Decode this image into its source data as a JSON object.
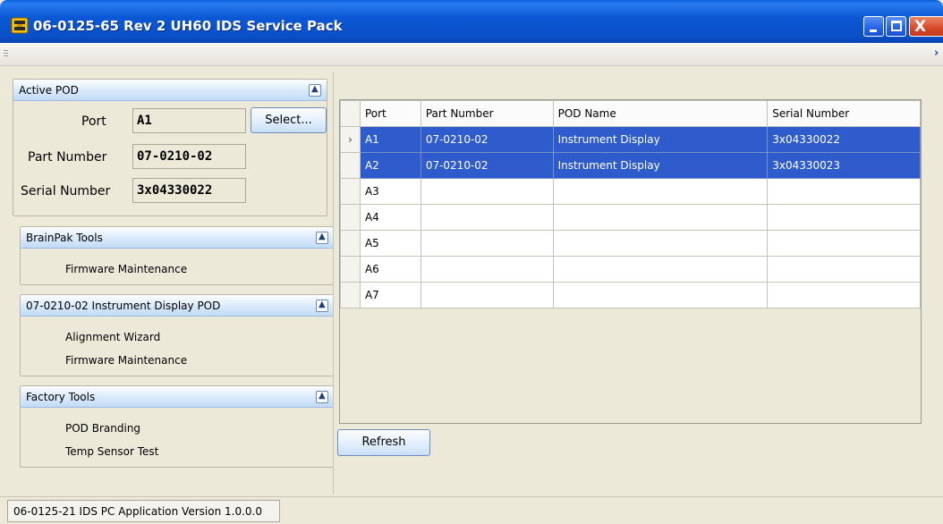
{
  "window": {
    "title": "06-0125-65 Rev 2 UH60 IDS Service Pack",
    "controls": {
      "minimize": "minimize",
      "maximize": "maximize",
      "close": "X"
    }
  },
  "toolstrip": {
    "overflow_glyph": "›"
  },
  "active_pod": {
    "header": "Active POD",
    "port_label": "Port",
    "port_value": "A1",
    "select_label": "Select...",
    "part_number_label": "Part Number",
    "part_number_value": "07-0210-02",
    "serial_number_label": "Serial Number",
    "serial_number_value": "3x04330022"
  },
  "brainpak_tools": {
    "header": "BrainPak Tools",
    "items": [
      "Firmware Maintenance"
    ]
  },
  "instrument_pod": {
    "header": "07-0210-02 Instrument Display POD",
    "items": [
      "Alignment Wizard",
      "Firmware Maintenance"
    ]
  },
  "factory_tools": {
    "header": "Factory Tools",
    "items": [
      "POD Branding",
      "Temp Sensor Test"
    ]
  },
  "grid": {
    "columns": [
      "Port",
      "Part Number",
      "POD Name",
      "Serial Number"
    ],
    "rows": [
      {
        "marker": "›",
        "port": "A1",
        "part_number": "07-0210-02",
        "pod_name": "Instrument Display",
        "serial": "3x04330022",
        "selected": true
      },
      {
        "marker": "",
        "port": "A2",
        "part_number": "07-0210-02",
        "pod_name": "Instrument Display",
        "serial": "3x04330023",
        "selected": true
      },
      {
        "marker": "",
        "port": "A3",
        "part_number": "",
        "pod_name": "",
        "serial": "",
        "selected": false
      },
      {
        "marker": "",
        "port": "A4",
        "part_number": "",
        "pod_name": "",
        "serial": "",
        "selected": false
      },
      {
        "marker": "",
        "port": "A5",
        "part_number": "",
        "pod_name": "",
        "serial": "",
        "selected": false
      },
      {
        "marker": "",
        "port": "A6",
        "part_number": "",
        "pod_name": "",
        "serial": "",
        "selected": false
      },
      {
        "marker": "",
        "port": "A7",
        "part_number": "",
        "pod_name": "",
        "serial": "",
        "selected": false
      }
    ]
  },
  "refresh_label": "Refresh",
  "status": {
    "text": "06-0125-21 IDS PC Application Version 1.0.0.0"
  },
  "colors": {
    "selection": "#2f5ccd",
    "titlebar": "#0a4fc8",
    "panel_header": "#c2dbf6"
  },
  "icons": {
    "app": "yellow-pod-icon",
    "collapse": "chevron-up-icon"
  }
}
